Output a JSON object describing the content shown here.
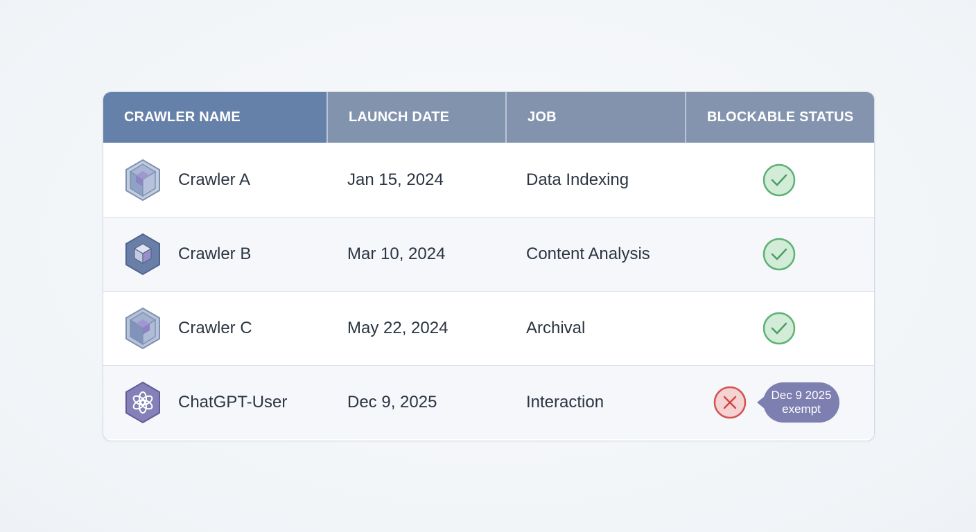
{
  "table": {
    "headers": {
      "name": "CRAWLER NAME",
      "date": "LAUNCH DATE",
      "job": "JOB",
      "status": "BLOCKABLE STATUS"
    },
    "rows": [
      {
        "name": "Crawler A",
        "date": "Jan 15, 2024",
        "job": "Data Indexing",
        "blockable": true,
        "icon": "cube-hexagon-icon"
      },
      {
        "name": "Crawler B",
        "date": "Mar 10, 2024",
        "job": "Content Analysis",
        "blockable": true,
        "icon": "cube-hexagon-icon"
      },
      {
        "name": "Crawler C",
        "date": "May 22, 2024",
        "job": "Archival",
        "blockable": true,
        "icon": "cube-hexagon-icon"
      },
      {
        "name": "ChatGPT-User",
        "date": "Dec 9, 2025",
        "job": "Interaction",
        "blockable": false,
        "icon": "openai-logo-icon",
        "note_line1": "Dec 9 2025",
        "note_line2": "exempt"
      }
    ]
  },
  "colors": {
    "header_primary": "#6580a9",
    "header_secondary": "#8293ae",
    "check_green": "#4fae6a",
    "block_red": "#d9534f",
    "badge_purple": "#7e7fb1"
  }
}
